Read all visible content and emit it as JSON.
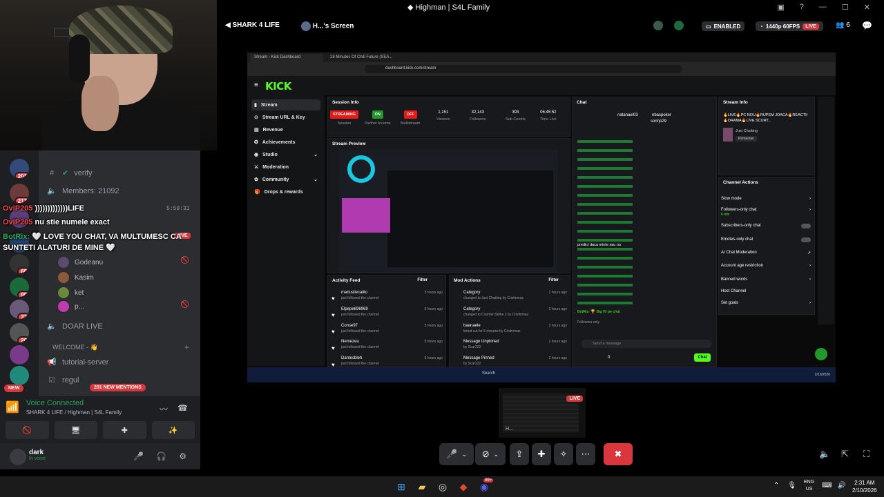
{
  "window": {
    "title": "Highman | S4L Family",
    "title_icon": "discord-logo-icon"
  },
  "stream_bar": {
    "server_name": "SHARK 4 LIFE",
    "screen_label": "H...'s Screen",
    "enabled_label": "ENABLED",
    "quality_label": "1440p 60FPS",
    "live_label": "LIVE",
    "viewer_count": "6"
  },
  "channels": {
    "items": [
      {
        "name": "verify",
        "icon": "hash-icon"
      },
      {
        "name": "Members: 21092",
        "icon": "speaker-icon"
      },
      {
        "name": "DOAR LIVE",
        "icon": "speaker-icon"
      },
      {
        "name": "tutorial-server",
        "icon": "megaphone-icon"
      },
      {
        "name": "regul",
        "icon": "rules-icon"
      }
    ],
    "category": "WELCOME - 👋",
    "voice_users": [
      "Godeanu",
      "Kasim",
      "ket",
      "p..."
    ],
    "stream_time": "5:59:31",
    "new_mentions": "201 NEW MENTIONS",
    "new_label": "NEW"
  },
  "servers": [
    {
      "badge": "201"
    },
    {
      "badge": "217"
    },
    {
      "badge": ""
    },
    {
      "badge": ""
    },
    {
      "badge": "68"
    },
    {
      "badge": "99"
    },
    {
      "badge": "37"
    },
    {
      "badge": "20"
    },
    {
      "badge": ""
    },
    {
      "badge": ""
    }
  ],
  "overlay_chat": [
    {
      "user": "OviP205",
      "text": ")))))))))))))LIFE"
    },
    {
      "user": "OviP205",
      "text": "nu stie numele exact"
    },
    {
      "user": "BotRix:",
      "text": "🤍 LOVE YOU CHAT, VA MULTUMESC CA"
    },
    {
      "user": "",
      "text": "SUNTETI ALATURI DE MINE 🤍"
    }
  ],
  "voice": {
    "status": "Voice Connected",
    "location": "SHARK 4 LIFE / Highman | S4L Family"
  },
  "user": {
    "name": "dark",
    "status": "In voice"
  },
  "browser": {
    "tab1": "Stream - Kick Dashboard",
    "tab2": "28 Minutes Of Chill Future (SEA...",
    "url": "dashboard.kick.com/stream"
  },
  "kick": {
    "logo": "KICK",
    "nav": [
      {
        "label": "Stream",
        "icon": "stream-icon"
      },
      {
        "label": "Stream URL & Key",
        "icon": "key-icon"
      },
      {
        "label": "Revenue",
        "icon": "revenue-icon"
      },
      {
        "label": "Achievements",
        "icon": "trophy-icon"
      },
      {
        "label": "Studio",
        "icon": "studio-icon"
      },
      {
        "label": "Moderation",
        "icon": "sword-icon"
      },
      {
        "label": "Community",
        "icon": "community-icon"
      },
      {
        "label": "Drops & rewards",
        "icon": "gift-icon"
      }
    ],
    "session": {
      "title": "Session Info",
      "session_badge": "STREAMING",
      "session_label": "Session",
      "partner_badge": "ON",
      "partner_label": "Partner Income",
      "multi_badge": "OFF",
      "multi_label": "Multistream",
      "viewers": "1,151",
      "viewers_label": "Viewers",
      "followers": "32,143",
      "followers_label": "Followers",
      "subs": "393",
      "subs_label": "Sub Counts",
      "time": "06:45:52",
      "time_label": "Time Live"
    },
    "preview_title": "Stream Preview",
    "activity": {
      "title": "Activity Feed",
      "filter": "Filter",
      "items": [
        {
          "name": "mariusilecalito",
          "sub": "just followed the channel",
          "time": "3 hours ago"
        },
        {
          "name": "Elpepe696969",
          "sub": "just followed the channel",
          "time": "5 hours ago"
        },
        {
          "name": "Conse97",
          "sub": "just followed the channel",
          "time": "5 hours ago"
        },
        {
          "name": "Nemezeu",
          "sub": "just followed the channel",
          "time": "5 hours ago"
        },
        {
          "name": "Dantesbleh",
          "sub": "just followed the channel",
          "time": "6 hours ago"
        }
      ]
    },
    "mod": {
      "title": "Mod Actions",
      "filter": "Filter",
      "items": [
        {
          "name": "Category",
          "sub": "changed to Just Chatting by Cristinmax",
          "time": "2 hours ago"
        },
        {
          "name": "Category",
          "sub": "changed to Counter-Strike 2 by Cristinmax",
          "time": "2 hours ago"
        },
        {
          "name": "baanaele",
          "sub": "timed out for 5 minutes by Cristinmax",
          "time": "2 hours ago"
        },
        {
          "name": "Message Unpinned",
          "sub": "by Scar222",
          "time": "2 hours ago"
        },
        {
          "name": "Message Pinned",
          "sub": "by Scar222",
          "time": "2 hours ago"
        }
      ]
    },
    "chat": {
      "title": "Chat",
      "top1": "natanael03",
      "top2": "nbaspoker",
      "top3": "sorinp29",
      "message": "predict daca minte sau nu",
      "bot_message": "BotRix: 🏆 Big W pe chat",
      "followers_only": "Followers only",
      "send_placeholder": "Send a message",
      "chat_button": "Chat",
      "count": "0"
    },
    "stream_info": {
      "title": "Stream Info",
      "stream_title": "🔥LIVE🔥PC NOU🔥RUPEM JOACA🔥REACTII🔥DRAMA🔥LIVE SCURT...",
      "category": "Just Chatting",
      "tag": "Romanian"
    },
    "channel_actions": {
      "title": "Channel Actions",
      "items": [
        {
          "label": "Slow mode"
        },
        {
          "label": "Followers-only chat",
          "sub": "6 min"
        },
        {
          "label": "Subscribers-only chat"
        },
        {
          "label": "Emotes-only chat"
        },
        {
          "label": "AI Chat Moderation"
        },
        {
          "label": "Account age restriction"
        },
        {
          "label": "Banned words"
        },
        {
          "label": "Host Channel"
        },
        {
          "label": "Set goals"
        }
      ]
    }
  },
  "inner_taskbar": {
    "search": "Search",
    "date": "2/10/2026"
  },
  "mini": {
    "live": "LIVE",
    "label": "H..."
  },
  "taskbar": {
    "time": "2:31 AM",
    "date": "2/10/2026",
    "lang1": "ENG",
    "lang2": "US",
    "discord_badge": "99+"
  },
  "colors": {
    "kick_green": "#53fc18",
    "discord_red": "#da373c",
    "voice_green": "#23a55a"
  }
}
